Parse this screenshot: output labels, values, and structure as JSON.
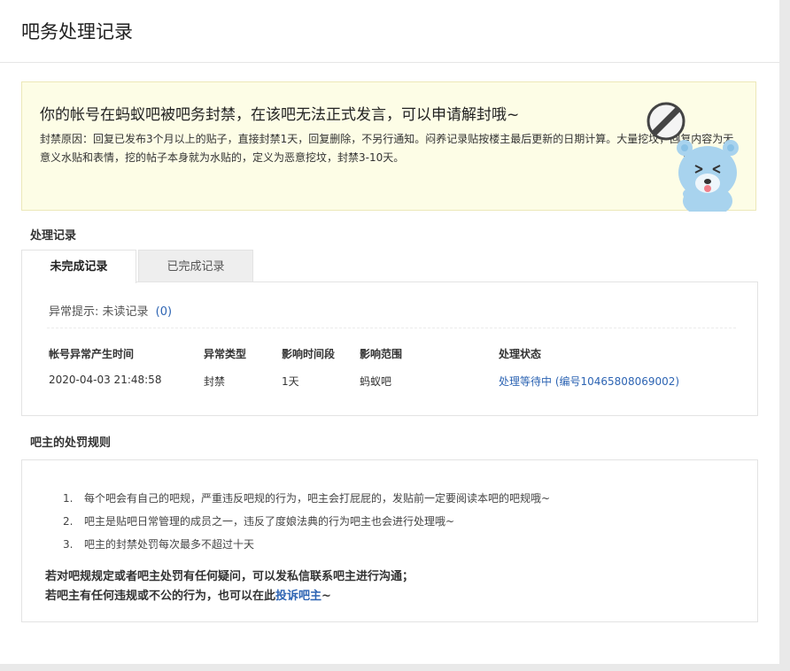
{
  "header": {
    "title": "吧务处理记录"
  },
  "notice": {
    "headline": "你的帐号在蚂蚁吧被吧务封禁，在该吧无法正式发言，可以申请解封哦~",
    "reason": "封禁原因：回复已发布3个月以上的贴子，直接封禁1天，回复删除，不另行通知。闷养记录贴按楼主最后更新的日期计算。大量挖坟，回复内容为无意义水贴和表情，挖的帖子本身就为水贴的，定义为恶意挖坟，封禁3-10天。"
  },
  "records": {
    "section_title": "处理记录",
    "tabs": [
      {
        "label": "未完成记录",
        "active": true
      },
      {
        "label": "已完成记录",
        "active": false
      }
    ],
    "anomaly_label": "异常提示: 未读记录",
    "anomaly_count": "(0)",
    "columns": [
      "帐号异常产生时间",
      "异常类型",
      "影响时间段",
      "影响范围",
      "处理状态"
    ],
    "rows": [
      {
        "time": "2020-04-03 21:48:58",
        "type": "封禁",
        "duration": "1天",
        "scope": "蚂蚁吧",
        "status": "处理等待中 (编号10465808069002)"
      }
    ]
  },
  "rules": {
    "section_title": "吧主的处罚规则",
    "items": [
      {
        "num": "1.",
        "text": "每个吧会有自己的吧规，严重违反吧规的行为，吧主会打屁屁的，发贴前一定要阅读本吧的吧规哦~"
      },
      {
        "num": "2.",
        "text": "吧主是贴吧日常管理的成员之一，违反了度娘法典的行为吧主也会进行处理哦~"
      },
      {
        "num": "3.",
        "text": "吧主的封禁处罚每次最多不超过十天"
      }
    ],
    "footer_line1": "若对吧规规定或者吧主处罚有任何疑问，可以发私信联系吧主进行沟通；",
    "footer_line2_prefix": "若吧主有任何违规或不公的行为，也可以在此",
    "footer_link": "投诉吧主",
    "footer_suffix": "~"
  },
  "colors": {
    "link": "#2d64b3",
    "notice_bg": "#fdfde6"
  }
}
